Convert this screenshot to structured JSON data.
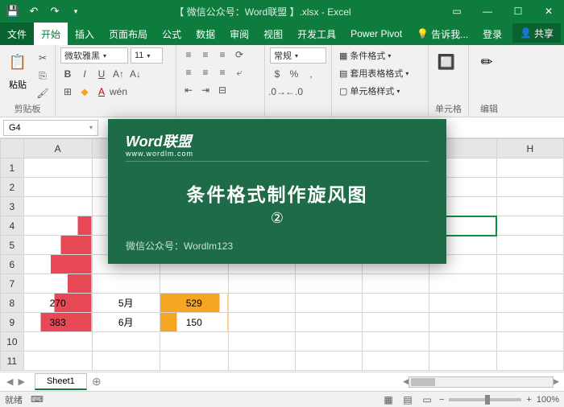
{
  "window": {
    "title": "【 微信公众号：Word联盟 】.xlsx - Excel"
  },
  "tabs": {
    "file": "文件",
    "active": "开始",
    "items": [
      "插入",
      "页面布局",
      "公式",
      "数据",
      "审阅",
      "视图",
      "开发工具",
      "Power Pivot"
    ],
    "tellme": "告诉我...",
    "login": "登录",
    "share": "共享"
  },
  "ribbon": {
    "clipboard": {
      "label": "剪贴板",
      "paste": "粘贴"
    },
    "font": {
      "name": "微软雅黑",
      "size": "11"
    },
    "number": {
      "format": "常规"
    },
    "styles": {
      "cond": "条件格式",
      "table": "套用表格格式",
      "cell": "单元格样式"
    },
    "cells": {
      "label": "单元格"
    },
    "editing": {
      "label": "编辑"
    }
  },
  "namebox": "G4",
  "columns": [
    "A",
    "",
    "",
    "",
    "",
    "",
    "",
    "H"
  ],
  "rows": [
    "1",
    "2",
    "3",
    "4",
    "5",
    "6",
    "7",
    "8",
    "9",
    "10",
    "11"
  ],
  "data": {
    "r8": {
      "a": "270",
      "b": "5月",
      "c": "529"
    },
    "r9": {
      "a": "383",
      "b": "6月",
      "c": "150"
    }
  },
  "sheet": "Sheet1",
  "status": {
    "ready": "就绪",
    "ime": "",
    "zoom": "100%"
  },
  "overlay": {
    "logo": "Word联盟",
    "url": "www.wordlm.com",
    "title": "条件格式制作旋风图",
    "num": "②",
    "foot": "微信公众号：Wordlm123"
  }
}
